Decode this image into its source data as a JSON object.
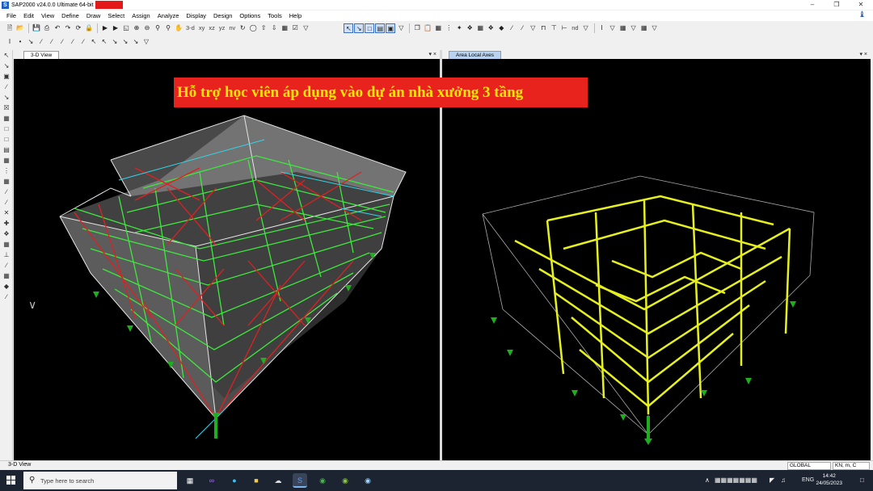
{
  "window": {
    "title": "SAP2000 v24.0.0 Ultimate 64-bit",
    "app_icon": "S",
    "controls": [
      "–",
      "❐",
      "✕"
    ]
  },
  "menu": [
    "File",
    "Edit",
    "View",
    "Define",
    "Draw",
    "Select",
    "Assign",
    "Analyze",
    "Display",
    "Design",
    "Options",
    "Tools",
    "Help"
  ],
  "toolbar": {
    "view_labels": [
      "3-d",
      "xy",
      "xz",
      "yz",
      "nv"
    ],
    "dim_label": "nd"
  },
  "panes": {
    "left_title": "3-D View",
    "right_title": "Area Local Axes",
    "controls": "▾ ×"
  },
  "banner": {
    "text": "Hỗ trợ học viên áp dụng vào dự án nhà xưởng  3 tầng",
    "background": "#e8221c",
    "color": "#ffe800"
  },
  "status": {
    "left": "3-D View",
    "coord_system": "GLOBAL",
    "units": "KN, m, C"
  },
  "taskbar": {
    "search_placeholder": "Type here to search",
    "language": "ENG",
    "time": "14:42",
    "date": "24/05/2023"
  }
}
